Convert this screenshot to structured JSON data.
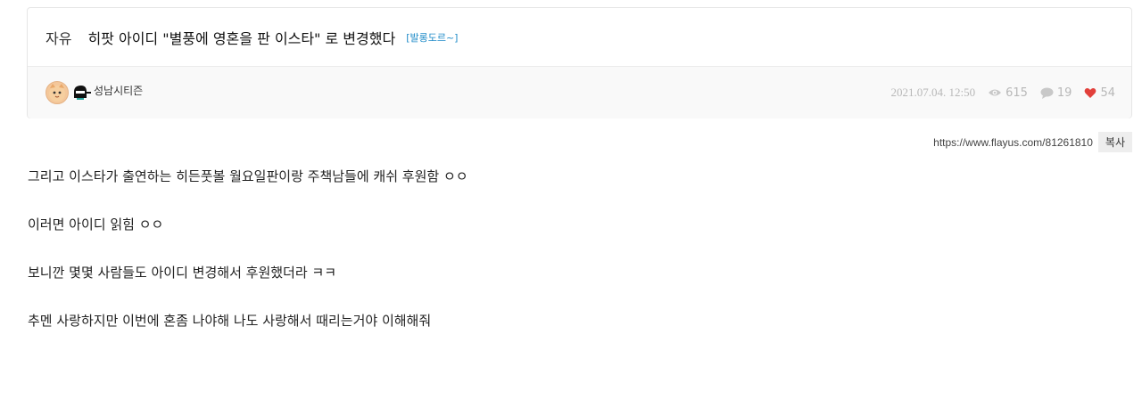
{
  "post": {
    "category": "자유",
    "title": "히팟 아이디 \"별풍에 영혼을 판 이스타\" 로 변경했다",
    "tag": "[발롱도르~]"
  },
  "meta": {
    "author": "성남시티즌",
    "date": "2021.07.04. 12:50",
    "views": "615",
    "comments": "19",
    "likes": "54",
    "avatar_icon": "cat-face-icon",
    "level_icon": "ninja-level-icon",
    "colors": {
      "heart": "#e2403b",
      "tag": "#1e8bc8"
    }
  },
  "share": {
    "url": "https://www.flayus.com/81261810",
    "copy_label": "복사"
  },
  "content": {
    "paragraphs": [
      "그리고 이스타가 출연하는 히든풋볼 월요일판이랑 주책남들에 캐쉬 후원함 ㅇㅇ",
      "이러면 아이디 읽힘 ㅇㅇ",
      "보니깐 몇몇 사람들도 아이디 변경해서 후원했더라 ㅋㅋ",
      "추멘 사랑하지만 이번에 혼좀 나야해 나도 사랑해서 때리는거야 이해해줘"
    ]
  }
}
